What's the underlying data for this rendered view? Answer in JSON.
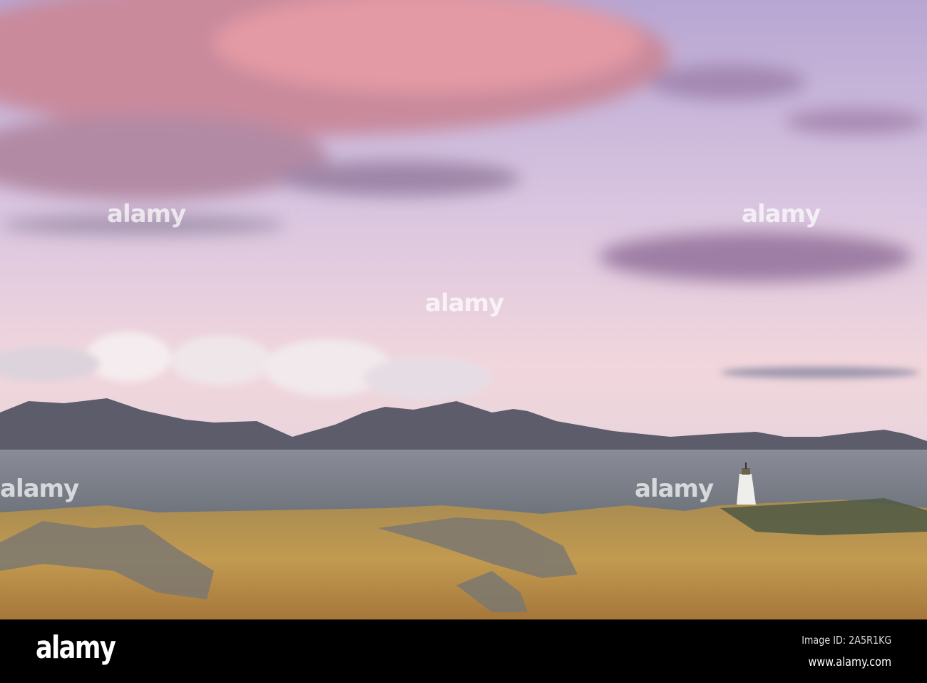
{
  "photo": {
    "subject": "Lighthouse on grassy headland with mountains across the sea at sunset",
    "colors": {
      "sky_top": "#b9a9d6",
      "sky_bottom": "#f0d3d8",
      "cloud_pink": "#d98a9a",
      "sea": "#7a7f88",
      "grass": "#b8914a"
    }
  },
  "watermark": {
    "text": "alamy"
  },
  "footer": {
    "logo": "alamy",
    "image_id": "Image ID: 2A5R1KG",
    "website": "www.alamy.com"
  }
}
